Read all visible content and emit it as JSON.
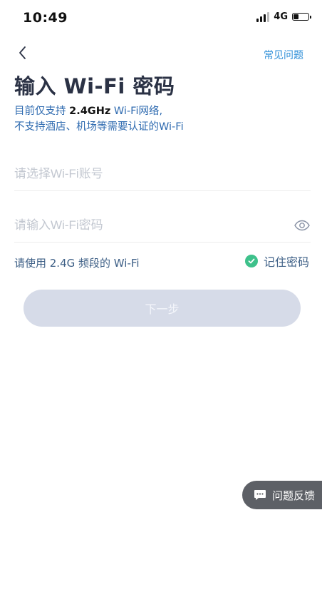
{
  "status_bar": {
    "time": "10:49",
    "network": "4G"
  },
  "nav": {
    "faq_label": "常见问题"
  },
  "header": {
    "title": "输入 Wi-Fi 密码",
    "subtitle_prefix": "目前仅支持 ",
    "subtitle_band": "2.4GHz",
    "subtitle_suffix": " Wi-Fi网络,",
    "subtitle_line2": "不支持酒店、机场等需要认证的Wi-Fi"
  },
  "form": {
    "ssid_placeholder": "请选择Wi-Fi账号",
    "password_placeholder": "请输入Wi-Fi密码",
    "band_hint": "请使用 2.4G 频段的 Wi-Fi",
    "remember_label": "记住密码",
    "remember_checked": true,
    "next_label": "下一步"
  },
  "feedback": {
    "label": "问题反馈"
  },
  "colors": {
    "accent": "#2f8fd8",
    "check": "#3ec18b",
    "button_disabled": "#d6dbe8",
    "feedback_bg": "#5d6066"
  }
}
